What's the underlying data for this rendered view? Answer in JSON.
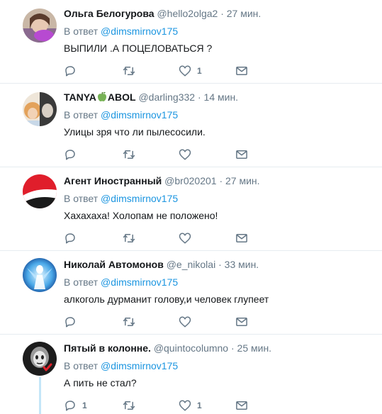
{
  "reply_prefix": "В ответ",
  "tweets": [
    {
      "name": "Ольга Белогурова",
      "handle": "@hello2olga2",
      "dot": "·",
      "time": "27 мин.",
      "mention": "@dimsmirnov175",
      "text": "ВЫПИЛИ .А ПОЦЕЛОВАТЬСЯ ?",
      "reply_count": "",
      "retweet_count": "",
      "like_count": "1"
    },
    {
      "name_part1": "TANYA",
      "name_part2": "ABOL",
      "name_emoji": "green-apple-icon",
      "handle": "@darling332",
      "dot": "·",
      "time": "14 мин.",
      "mention": "@dimsmirnov175",
      "text": "Улицы зря что ли пылесосили.",
      "reply_count": "",
      "retweet_count": "",
      "like_count": ""
    },
    {
      "name": "Агент Иностранный",
      "handle": "@br020201",
      "dot": "·",
      "time": "27 мин.",
      "mention": "@dimsmirnov175",
      "text": "Хахахаха! Холопам не положено!",
      "reply_count": "",
      "retweet_count": "",
      "like_count": ""
    },
    {
      "name": "Николай Автомонов",
      "handle": "@e_nikolai",
      "dot": "·",
      "time": "33 мин.",
      "mention": "@dimsmirnov175",
      "text": "алкоголь дурманит голову,и человек глупеет",
      "reply_count": "",
      "retweet_count": "",
      "like_count": ""
    },
    {
      "name": "Пятый в колонне.",
      "handle": "@quintocolumno",
      "dot": "·",
      "time": "25 мин.",
      "mention": "@dimsmirnov175",
      "text": "А пить не стал?",
      "reply_count": "1",
      "retweet_count": "",
      "like_count": "1"
    }
  ],
  "colors": {
    "link": "#1b95e0",
    "muted": "#657786",
    "text": "#14171a",
    "divider": "#e6ecf0",
    "thread_line": "#c4e6f8"
  }
}
